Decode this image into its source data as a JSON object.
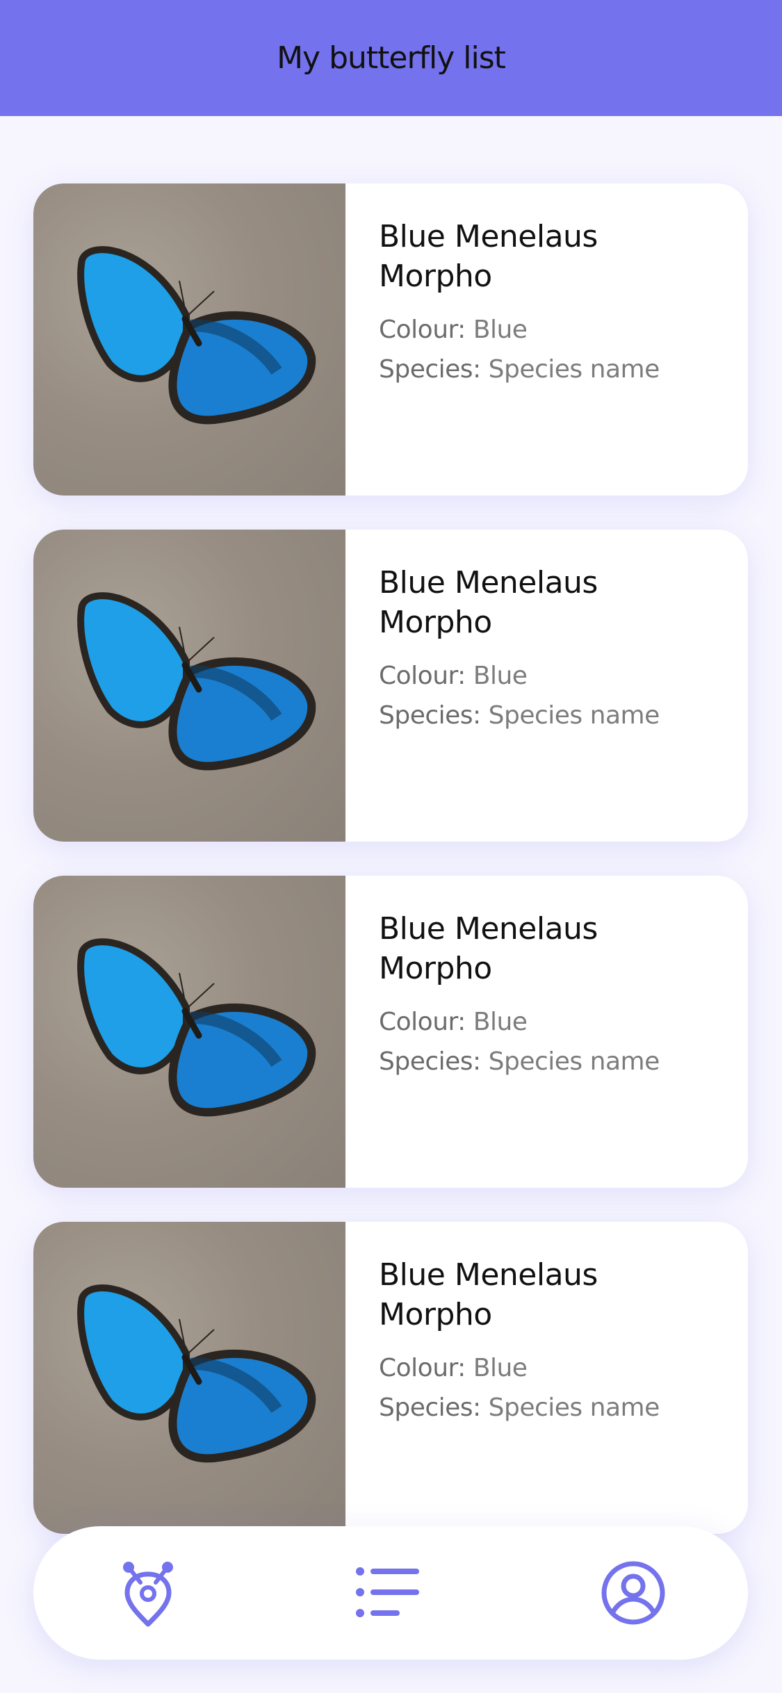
{
  "header": {
    "title": "My butterfly list"
  },
  "butterflies": [
    {
      "name": "Blue Menelaus Morpho",
      "colour_label": "Colour:",
      "colour": "Blue",
      "species_label": "Species:",
      "species": "Species name"
    },
    {
      "name": "Blue Menelaus Morpho",
      "colour_label": "Colour:",
      "colour": "Blue",
      "species_label": "Species:",
      "species": "Species name"
    },
    {
      "name": "Blue Menelaus Morpho",
      "colour_label": "Colour:",
      "colour": "Blue",
      "species_label": "Species:",
      "species": "Species name"
    },
    {
      "name": "Blue Menelaus Morpho",
      "colour_label": "Colour:",
      "colour": "Blue",
      "species_label": "Species:",
      "species": "Species name"
    }
  ],
  "nav": {
    "items": [
      {
        "icon": "butterfly-location-icon"
      },
      {
        "icon": "list-icon"
      },
      {
        "icon": "user-profile-icon"
      }
    ]
  },
  "colors": {
    "accent": "#7472ec",
    "background": "#f7f6fe",
    "card": "#ffffff",
    "title_text": "#111111",
    "secondary_text": "#7c7c7c"
  }
}
